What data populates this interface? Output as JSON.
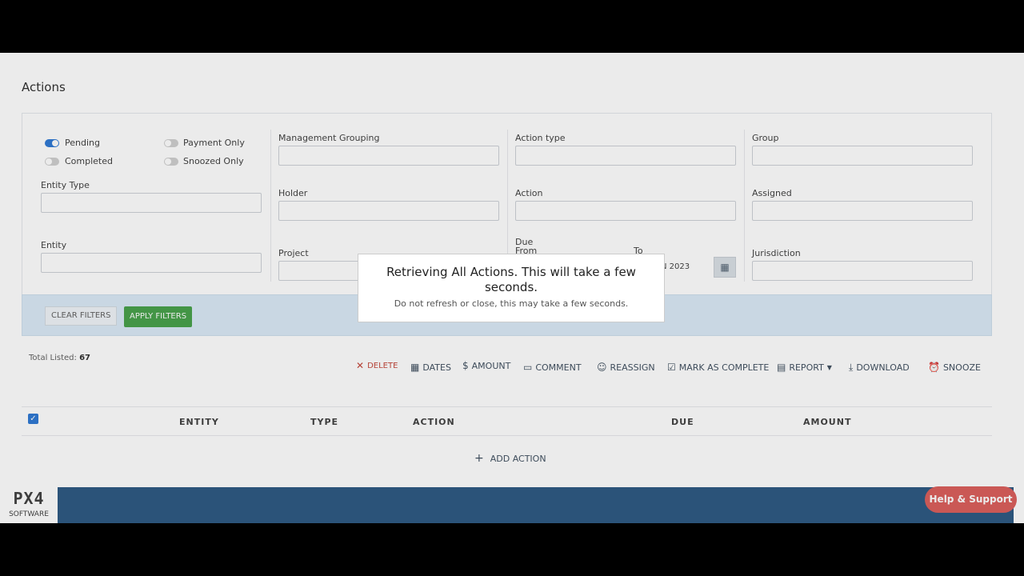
{
  "page": {
    "title": "Actions"
  },
  "filters": {
    "toggles": [
      {
        "label": "Pending",
        "on": true
      },
      {
        "label": "Completed",
        "on": false
      },
      {
        "label": "Payment Only",
        "on": false
      },
      {
        "label": "Snoozed Only",
        "on": false
      }
    ],
    "entity_type_label": "Entity Type",
    "entity_label": "Entity",
    "management_grouping_label": "Management Grouping",
    "holder_label": "Holder",
    "project_label": "Project",
    "action_type_label": "Action type",
    "action_label": "Action",
    "due_label": "Due",
    "from_label": "From",
    "to_label": "To",
    "to_value_partial": "N 2023",
    "group_label": "Group",
    "assigned_label": "Assigned",
    "jurisdiction_label": "Jurisdiction"
  },
  "filter_actions": {
    "clear": "CLEAR FILTERS",
    "apply": "APPLY FILTERS"
  },
  "summary": {
    "total_label": "Total Listed:",
    "total_value": "67"
  },
  "toolbar": {
    "delete": "DELETE",
    "dates": "DATES",
    "amount": "AMOUNT",
    "comment": "COMMENT",
    "reassign": "REASSIGN",
    "mark_complete": "MARK AS COMPLETE",
    "report": "REPORT",
    "download": "DOWNLOAD",
    "snooze": "SNOOZE"
  },
  "table": {
    "columns": [
      "ENTITY",
      "TYPE",
      "ACTION",
      "DUE",
      "AMOUNT"
    ],
    "add_action": "ADD ACTION"
  },
  "footer": {
    "logo_mark": "PX4",
    "logo_sub": "SOFTWARE",
    "help": "Help & Support"
  },
  "modal": {
    "title": "Retrieving All Actions. This will take a few seconds.",
    "subtitle": "Do not refresh or close, this may take a few seconds."
  },
  "colors": {
    "primary": "#1f6fd1",
    "apply": "#3a9b3e",
    "footer": "#1e4d7a",
    "help": "#d9534f",
    "delete": "#c0392b"
  }
}
